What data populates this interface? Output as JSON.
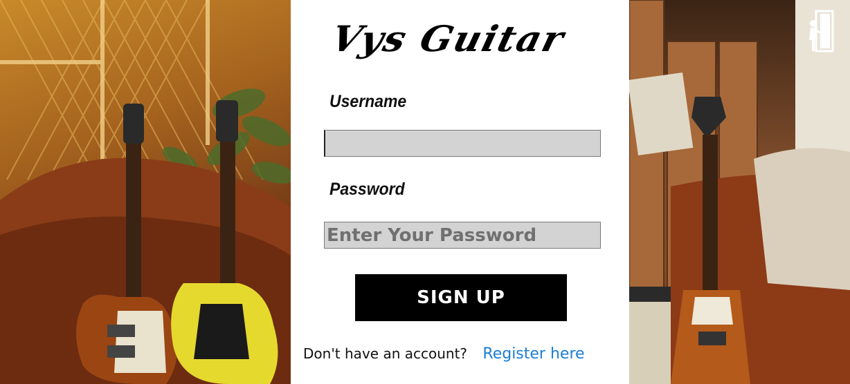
{
  "brand": {
    "title": "Vys Guitar"
  },
  "login_form": {
    "username_label": "Username",
    "username_value": "",
    "username_placeholder": "",
    "password_label": "Password",
    "password_placeholder": "Enter Your Password",
    "submit_label": "SIGN UP"
  },
  "footer": {
    "prompt_text": "Don't have an account?",
    "register_link": "Register here"
  },
  "icons": {
    "exit": "exit-door-icon"
  },
  "colors": {
    "button_bg": "#000000",
    "button_text": "#ffffff",
    "input_bg": "#d3d3d3",
    "link": "#1a7ed4"
  }
}
